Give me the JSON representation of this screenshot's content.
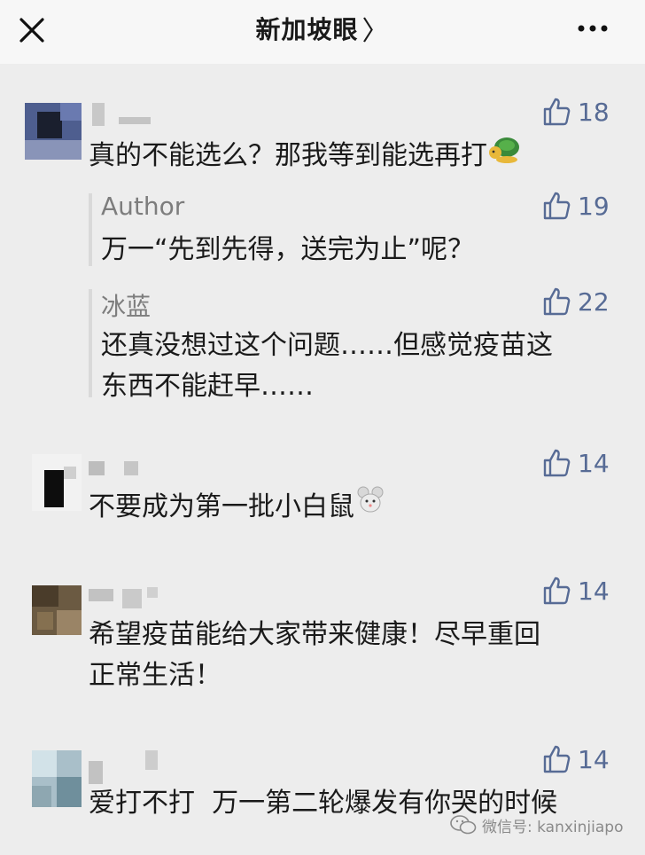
{
  "header": {
    "title": "新加坡眼",
    "chevron": "〉",
    "close_icon": "close-icon",
    "more_icon": "more-icon"
  },
  "comments": [
    {
      "text": "真的不能选么？那我等到能选再打",
      "likes": "18",
      "replies": [
        {
          "author": "Author",
          "text": "万一“先到先得，送完为止”呢？",
          "likes": "19"
        },
        {
          "author": "冰蓝",
          "text_line1": "还真没想过这个问题……但感觉疫苗这",
          "text_line2": "东西不能赶早……",
          "likes": "22"
        }
      ]
    },
    {
      "text": "不要成为第一批小白鼠",
      "likes": "14"
    },
    {
      "text_line1": "希望疫苗能给大家带来健康！尽早重回",
      "text_line2": "正常生活！",
      "likes": "14"
    },
    {
      "text": "爱打不打  万一第二轮爆发有你哭的时候",
      "likes": "14"
    }
  ],
  "watermark": {
    "text": "微信号: kanxinjiapo"
  },
  "colors": {
    "like_count": "#576b95",
    "background": "#ededed",
    "topbar": "#f7f7f7"
  }
}
